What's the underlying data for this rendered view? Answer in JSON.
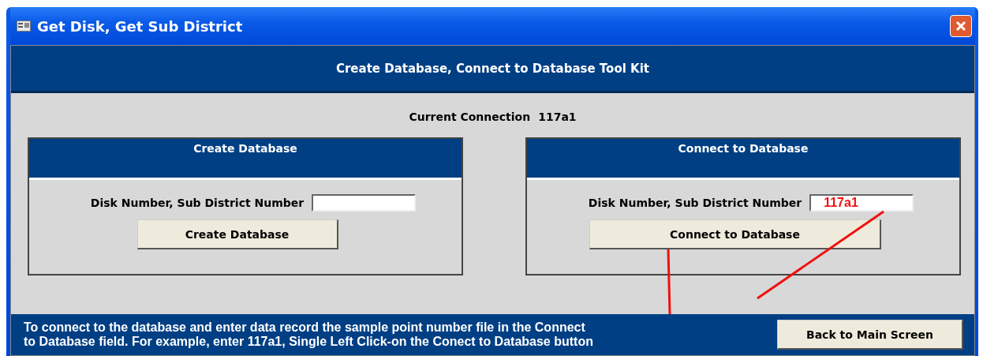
{
  "window": {
    "title": "Get Disk, Get Sub District"
  },
  "header": "Create Database, Connect to Database Tool Kit",
  "current_connection": {
    "label": "Current Connection",
    "value": "117a1"
  },
  "panels": [
    {
      "title": "Create Database",
      "field_label": "Disk Number, Sub District Number",
      "button": "Create Database"
    },
    {
      "title": "Connect to Database",
      "field_label": "Disk Number, Sub District Number",
      "value": "117a1",
      "button": "Connect to Database"
    }
  ],
  "note": "To connect to the database and enter data record the sample point number file in the Connect\nto Database field. For example, enter 117a1, Single Left Click-on the Conect to Database button",
  "back_button": "Back to Main Screen"
}
